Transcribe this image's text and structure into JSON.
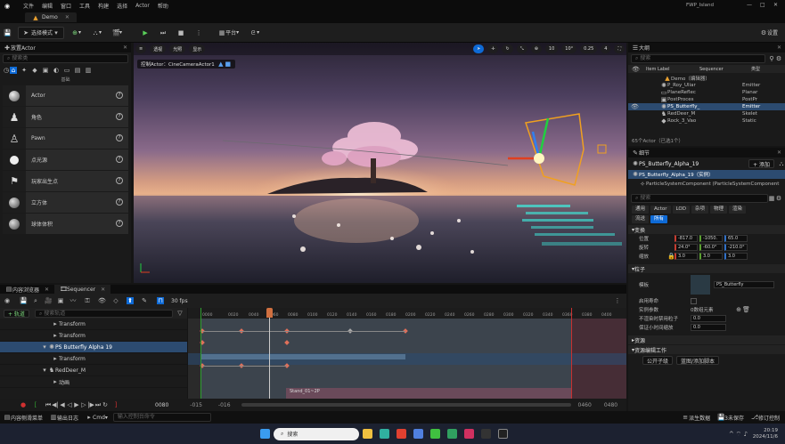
{
  "titlebar": {
    "menus": [
      "文件",
      "编辑",
      "窗口",
      "工具",
      "构建",
      "选择",
      "Actor",
      "帮助"
    ],
    "project": "FWP_Island"
  },
  "tabbar": {
    "level_tab": "Demo"
  },
  "toolbar": {
    "save_label": "",
    "mode_label": "选择模式",
    "platform_label": "平台",
    "settings_label": "设置"
  },
  "place_actors": {
    "title": "放置Actor",
    "search_placeholder": "搜索类",
    "category_label": "基础",
    "items": [
      {
        "label": "Actor",
        "icon": "sphere-icon"
      },
      {
        "label": "角色",
        "icon": "character-icon"
      },
      {
        "label": "Pawn",
        "icon": "pawn-icon"
      },
      {
        "label": "点光源",
        "icon": "point-light-icon"
      },
      {
        "label": "玩家出生点",
        "icon": "player-start-icon"
      },
      {
        "label": "立方体",
        "icon": "cube-icon"
      },
      {
        "label": "球体体积",
        "icon": "sphere-volume-icon"
      }
    ]
  },
  "viewport": {
    "perspective": "透视",
    "lit": "光照",
    "show": "显示",
    "pilot_label": "控制Actor：CineCameraActor1",
    "grid_snap": "10",
    "rot_snap": "10°",
    "scale_snap": "0.25",
    "cam_speed": "4"
  },
  "outliner": {
    "title": "大纲",
    "search_placeholder": "搜索",
    "col_item": "Item Label",
    "col_seq": "Sequencer",
    "col_type": "类型",
    "rows": [
      {
        "label": "Demo（编辑器）",
        "type": "",
        "depth": 0,
        "sel": false
      },
      {
        "label": "P_Roy_Uliar",
        "type": "Emitter",
        "depth": 1,
        "sel": false
      },
      {
        "label": "PlaneReflec",
        "type": "Planar",
        "depth": 1,
        "sel": false
      },
      {
        "label": "PostProces",
        "type": "PostPr",
        "depth": 1,
        "sel": false
      },
      {
        "label": "PS_Butterfly_",
        "type": "Emitter",
        "depth": 1,
        "sel": true
      },
      {
        "label": "RedDeer_M",
        "type": "Skelet",
        "depth": 1,
        "sel": false
      },
      {
        "label": "Rock_3_Vao",
        "type": "Static",
        "depth": 1,
        "sel": false
      }
    ],
    "footer": "65个Actor（已选1个）"
  },
  "details": {
    "title": "细节",
    "actor_name": "PS_Butterfly_Alpha_19",
    "add_label": "+ 添加",
    "instance_label": "PS_Butterfly_Alpha_19（实例）",
    "component_label": "ParticleSystemComponent (ParticleSystemComponent",
    "search_placeholder": "搜索",
    "tabs": [
      "通用",
      "Actor",
      "LOD",
      "杂项",
      "物理",
      "渲染",
      "流送",
      "所有"
    ],
    "active_tab": "所有",
    "transform_label": "变换",
    "loc_label": "位置",
    "rot_label": "旋转",
    "scale_label": "缩放",
    "loc": [
      "-817.0",
      "-1050.",
      "65.0"
    ],
    "rot": [
      "24.0°",
      "-60.0°",
      "-210.0°"
    ],
    "scale": [
      "3.0",
      "3.0",
      "3.0"
    ],
    "particles_label": "粒子",
    "template_label": "模板",
    "template_value": "PS_Butterfly",
    "p_rows": [
      "启用寿命",
      "实例参数",
      "不渲染时禁用粒子",
      "保证小时间缩放",
      "渲染"
    ],
    "inst_value": "0数组元素",
    "p_val1": "0.0",
    "p_val2": "0.0",
    "attach_label": "资源",
    "action_label": "资源编辑工作",
    "open_level": "公开子级",
    "bp_label": "蓝图/添加脚本"
  },
  "sequencer": {
    "tabs": [
      "内容浏览器",
      "Sequencer"
    ],
    "fps": "30 fps",
    "search_placeholder": "搜索轨道",
    "add_track": "+ 轨道",
    "current_frame": "0080",
    "tracks": [
      {
        "label": "Transform",
        "depth": 2,
        "sel": false
      },
      {
        "label": "Transform",
        "depth": 2,
        "sel": false
      },
      {
        "label": "PS Butterfly Alpha 19",
        "depth": 1,
        "sel": true
      },
      {
        "label": "Transform",
        "depth": 2,
        "sel": false
      },
      {
        "label": "RedDeer_M",
        "depth": 1,
        "sel": false
      },
      {
        "label": "动画",
        "depth": 2,
        "sel": false
      }
    ],
    "ruler": [
      "0000",
      "0020",
      "0040",
      "0060",
      "0080",
      "0100",
      "0120",
      "0140",
      "0160",
      "0180",
      "0200",
      "0220",
      "0240",
      "0260",
      "0280",
      "0300",
      "0320",
      "0340",
      "0360",
      "0380",
      "0400",
      "0420"
    ],
    "clip_label": "Stand_01~2P",
    "start": "-015",
    "end": "-016",
    "range_end": "0460",
    "range_end2": "0480",
    "frame_out": "0080"
  },
  "bottombar": {
    "content_drawer": "内容侧滑菜单",
    "output": "输出日志",
    "cmd": "Cmd",
    "cmd_placeholder": "输入控制台命令",
    "src_ctrl": "源码控制",
    "status": "派生数据",
    "unsaved": "3未保存",
    "revision": "修订控制"
  },
  "taskbar": {
    "search": "搜索",
    "time": "20:19",
    "date": "2024/11/6"
  }
}
